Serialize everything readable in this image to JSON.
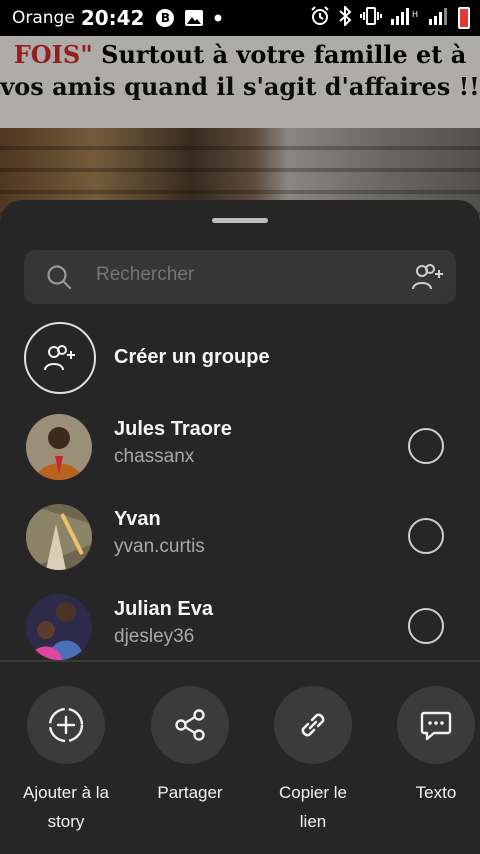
{
  "status_bar": {
    "carrier": "Orange",
    "time": "20:42",
    "badge_letter": "B"
  },
  "background_post": {
    "line1_red": "FOIS\"",
    "line1_black": " Surtout à votre famille et à",
    "line2": "vos amis quand il s'agit d'affaires !!"
  },
  "share_sheet": {
    "search": {
      "placeholder": "Rechercher"
    },
    "create_group": {
      "label": "Créer un groupe"
    },
    "contacts": [
      {
        "name": "Jules Traore",
        "username": "chassanx"
      },
      {
        "name": "Yvan",
        "username": "yvan.curtis"
      },
      {
        "name": "Julian Eva",
        "username": "djesley36"
      }
    ],
    "actions": [
      {
        "label_line1": "Ajouter à la",
        "label_line2": "story",
        "icon": "add-story-icon"
      },
      {
        "label_line1": "Partager",
        "label_line2": "",
        "icon": "share-icon"
      },
      {
        "label_line1": "Copier le",
        "label_line2": "lien",
        "icon": "link-icon"
      },
      {
        "label_line1": "Texto",
        "label_line2": "",
        "icon": "message-icon"
      }
    ]
  },
  "colors": {
    "sheet_background": "#262626",
    "search_background": "#363636",
    "secondary_text": "#a8a8a8",
    "action_circle": "#3b3b3b",
    "post_red": "#c62828"
  }
}
